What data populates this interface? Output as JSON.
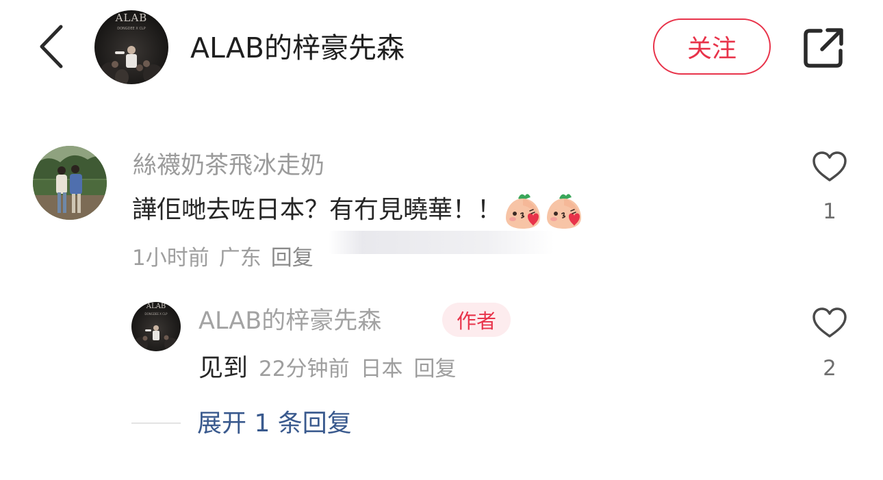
{
  "header": {
    "title": "ALAB的梓豪先森",
    "follow_label": "关注",
    "avatar_text": {
      "brand": "ALAB",
      "caption": "DONGDEE X CLP"
    }
  },
  "comments": [
    {
      "username": "絲襪奶茶飛冰走奶",
      "text": "譁佢哋去咗日本？有冇見曉華！！",
      "emojis": [
        "blowing-kiss-peach-emoji",
        "blowing-kiss-peach-emoji"
      ],
      "time": "1小时前",
      "location": "广东",
      "reply_label": "回复",
      "like_count": "1",
      "replies": [
        {
          "username": "ALAB的梓豪先森",
          "badge": "作者",
          "text": "见到",
          "time": "22分钟前",
          "location": "日本",
          "reply_label": "回复",
          "like_count": "2"
        }
      ],
      "expand_label": "展开 1 条回复"
    }
  ],
  "colors": {
    "accent_red": "#e8334a",
    "badge_bg": "#fdecee",
    "link_blue": "#3a5a8e",
    "muted_text": "#9e9e9e"
  },
  "icons": {
    "back": "chevron-left-icon",
    "share": "share-external-icon",
    "like": "heart-outline-icon"
  }
}
